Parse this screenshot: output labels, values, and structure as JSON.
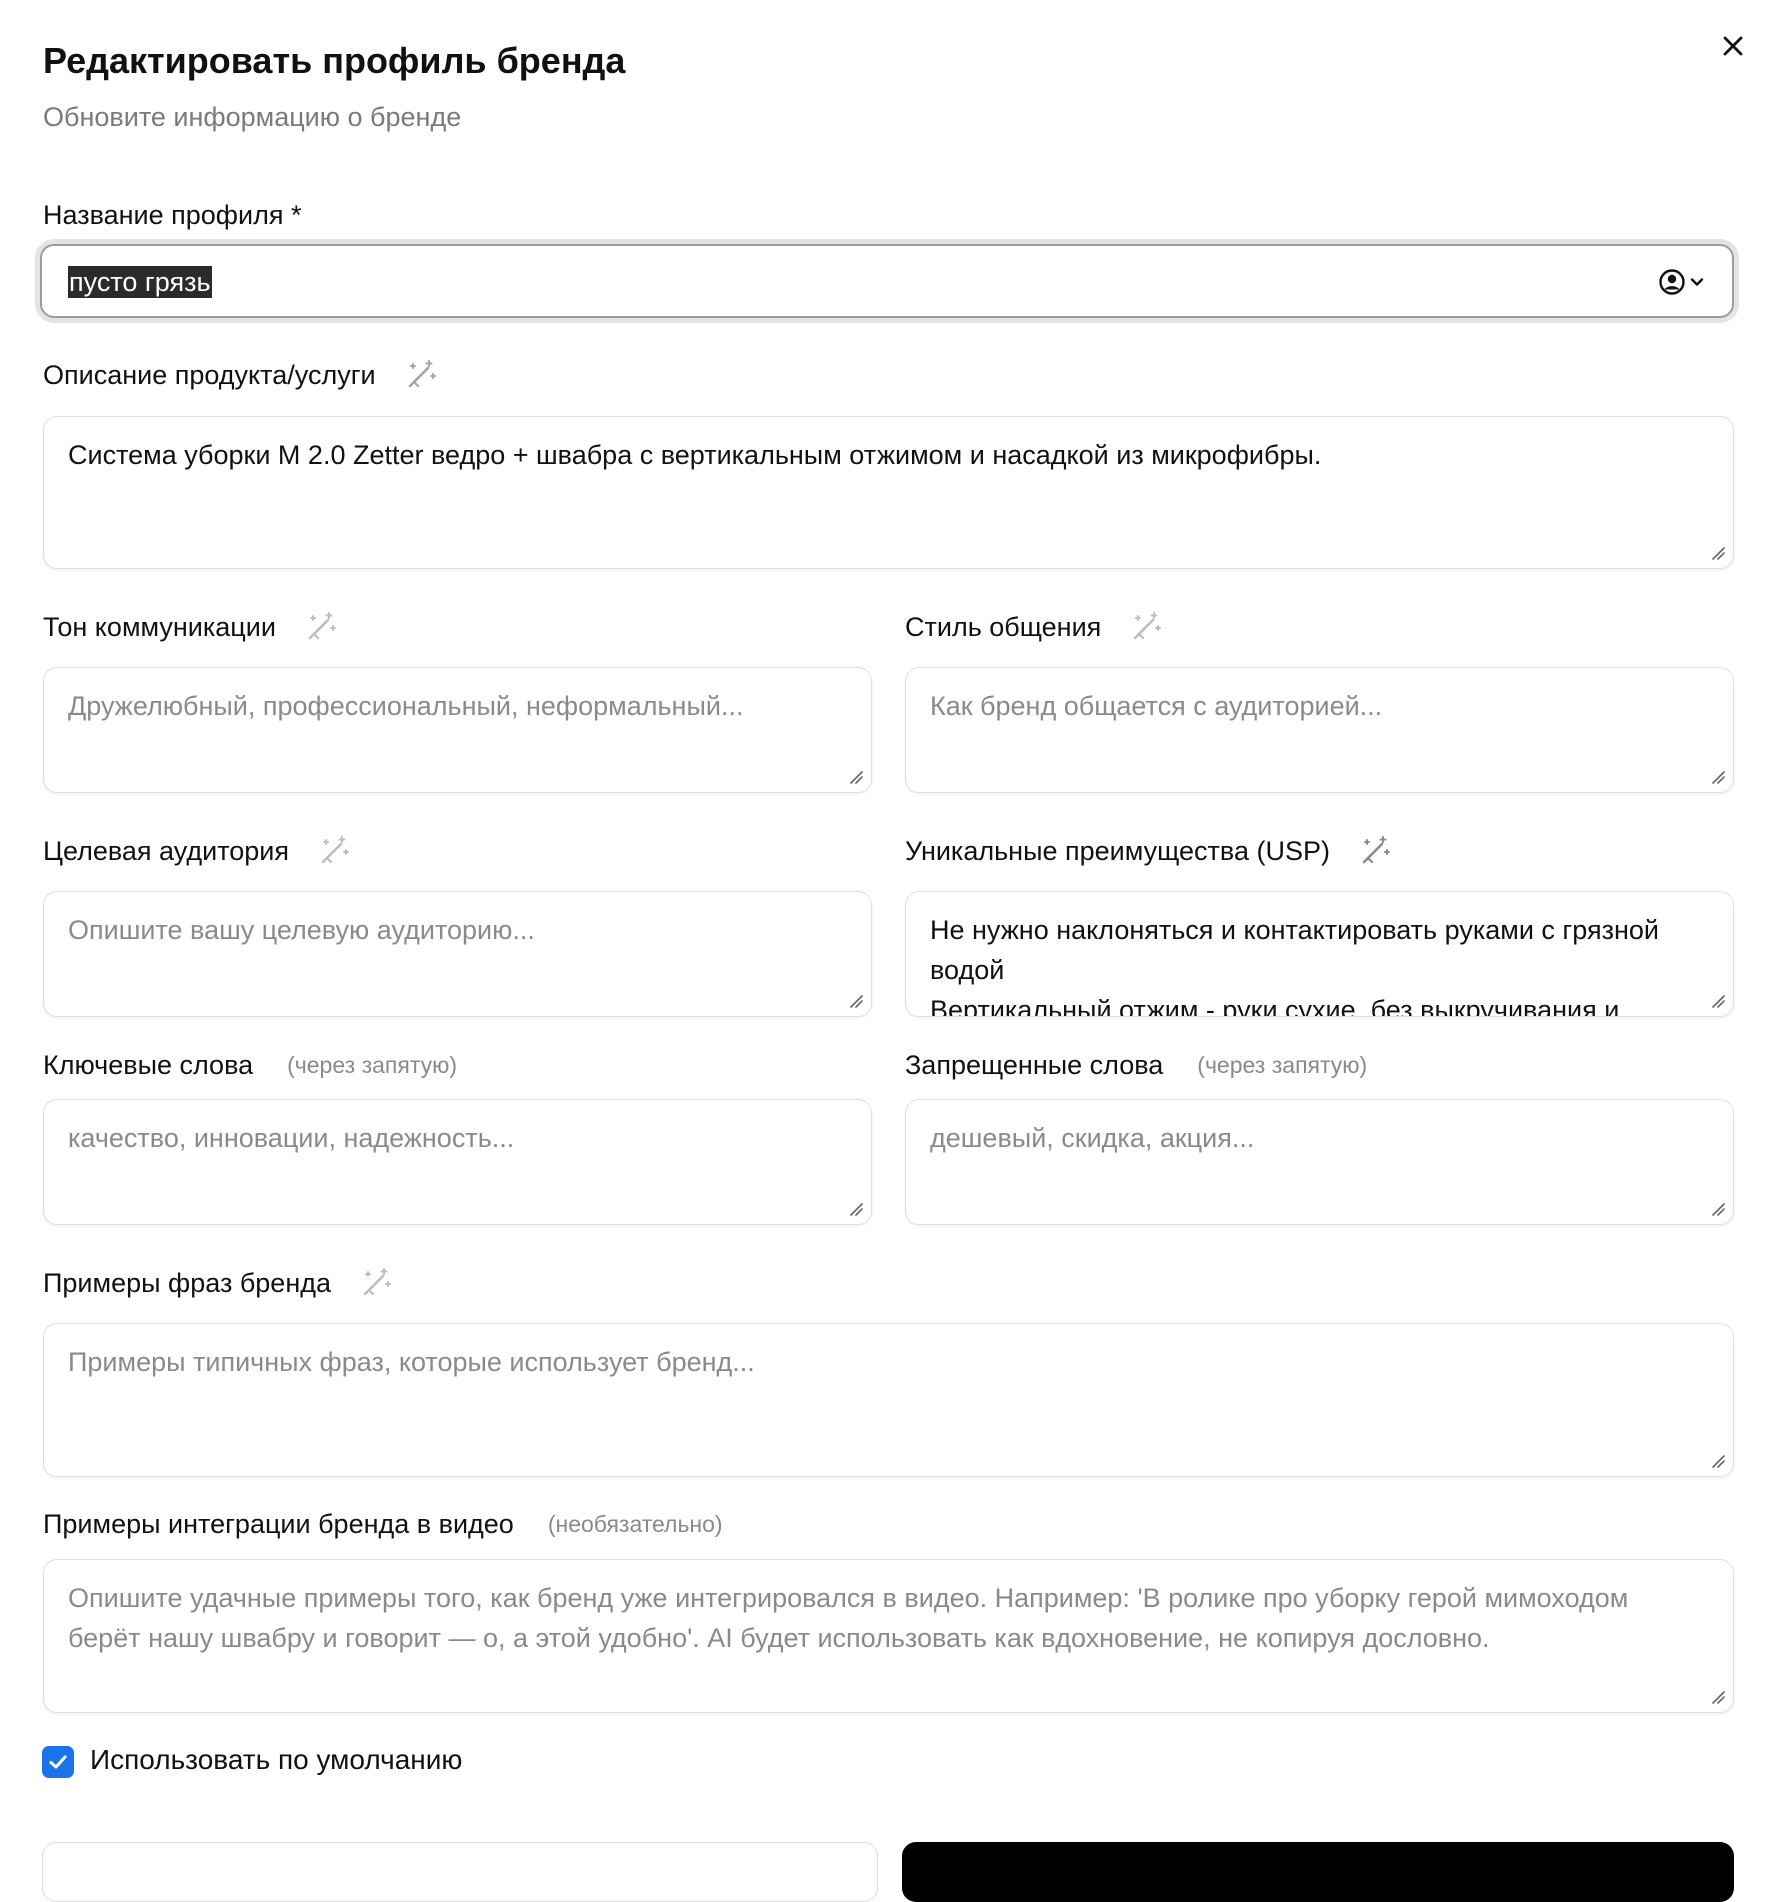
{
  "dialog": {
    "title": "Редактировать профиль бренда",
    "subtitle": "Обновите информацию о бренде",
    "close_icon": "close-icon"
  },
  "form": {
    "profile_name": {
      "label": "Название профиля *",
      "value": "пусто грязь",
      "trailing_icon": "user-circle-chevron-icon"
    },
    "product_description": {
      "label": "Описание продукта/услуги",
      "value": "Система уборки М 2.0 Zetter ведро + швабра с вертикальным отжимом и насадкой из микрофибры.",
      "placeholder": ""
    },
    "communication_tone": {
      "label": "Тон коммуникации",
      "value": "",
      "placeholder": "Дружелюбный, профессиональный, неформальный..."
    },
    "communication_style": {
      "label": "Стиль общения",
      "value": "",
      "placeholder": "Как бренд общается с аудиторией..."
    },
    "target_audience": {
      "label": "Целевая аудитория",
      "value": "",
      "placeholder": "Опишите вашу целевую аудиторию..."
    },
    "usp": {
      "label": "Уникальные преимущества (USP)",
      "value": "Не нужно наклоняться и контактировать руками с грязной водой\nВертикальный отжим - руки сухие, без выкручивания и",
      "placeholder": ""
    },
    "keywords": {
      "label": "Ключевые слова",
      "hint": "(через запятую)",
      "value": "",
      "placeholder": "качество, инновации, надежность..."
    },
    "forbidden_words": {
      "label": "Запрещенные слова",
      "hint": "(через запятую)",
      "value": "",
      "placeholder": "дешевый, скидка, акция..."
    },
    "brand_phrases": {
      "label": "Примеры фраз бренда",
      "value": "",
      "placeholder": "Примеры типичных фраз, которые использует бренд..."
    },
    "video_integration": {
      "label": "Примеры интеграции бренда в видео",
      "hint": "(необязательно)",
      "value": "",
      "placeholder": "Опишите удачные примеры того, как бренд уже интегрировался в видео. Например: 'В ролике про уборку герой мимоходом берёт нашу швабру и говорит — о, а этой удобно'. AI будет использовать как вдохновение, не копируя дословно."
    },
    "use_default": {
      "label": "Использовать по умолчанию",
      "checked": true
    }
  },
  "icons": {
    "ai_generate": "magic-wand-icon",
    "resize": "resize-grip-icon"
  },
  "colors": {
    "accent": "#1a73e8",
    "primary_button": "#000000",
    "placeholder_text": "#8a8a8a",
    "border": "#dedede"
  }
}
